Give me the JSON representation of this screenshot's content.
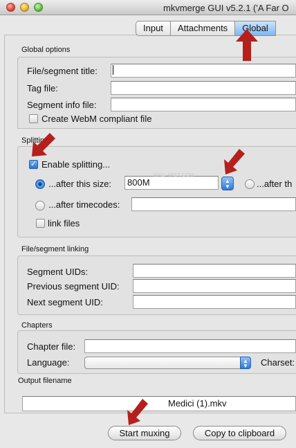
{
  "window": {
    "title": "mkvmerge GUI v5.2.1 ('A Far O"
  },
  "tabs": [
    {
      "label": "Input"
    },
    {
      "label": "Attachments"
    },
    {
      "label": "Global"
    }
  ],
  "global_options": {
    "section_label": "Global options",
    "file_segment_title_label": "File/segment title:",
    "file_segment_title_value": "",
    "tag_file_label": "Tag file:",
    "tag_file_value": "",
    "segment_info_file_label": "Segment info file:",
    "segment_info_file_value": "",
    "webm_label": "Create WebM compliant file",
    "webm_checked": false
  },
  "splitting": {
    "section_label": "Splitting",
    "enable_label": "Enable splitting...",
    "enable_checked": true,
    "after_size_label": "...after this size:",
    "after_size_value": "800M",
    "after_size_selected": true,
    "after_right_label": "...after th",
    "after_timecodes_label": "...after timecodes:",
    "after_timecodes_value": "",
    "link_files_label": "link files",
    "link_files_checked": false
  },
  "watermark": "MAC-4PET.COM",
  "linking": {
    "section_label": "File/segment linking",
    "segment_uids_label": "Segment UIDs:",
    "segment_uids_value": "",
    "previous_uid_label": "Previous segment UID:",
    "previous_uid_value": "",
    "next_uid_label": "Next segment UID:",
    "next_uid_value": ""
  },
  "chapters": {
    "section_label": "Chapters",
    "chapter_file_label": "Chapter file:",
    "chapter_file_value": "",
    "language_label": "Language:",
    "language_value": "",
    "charset_label": "Charset:"
  },
  "output": {
    "section_label": "Output filename",
    "filename": "Medici (1).mkv"
  },
  "buttons": {
    "start_muxing": "Start muxing",
    "copy_to_clipboard": "Copy to clipboard"
  },
  "colors": {
    "annotation_arrow": "#b5201c",
    "active_tab": "#7fb7ef",
    "control_accent": "#2f78d6"
  }
}
